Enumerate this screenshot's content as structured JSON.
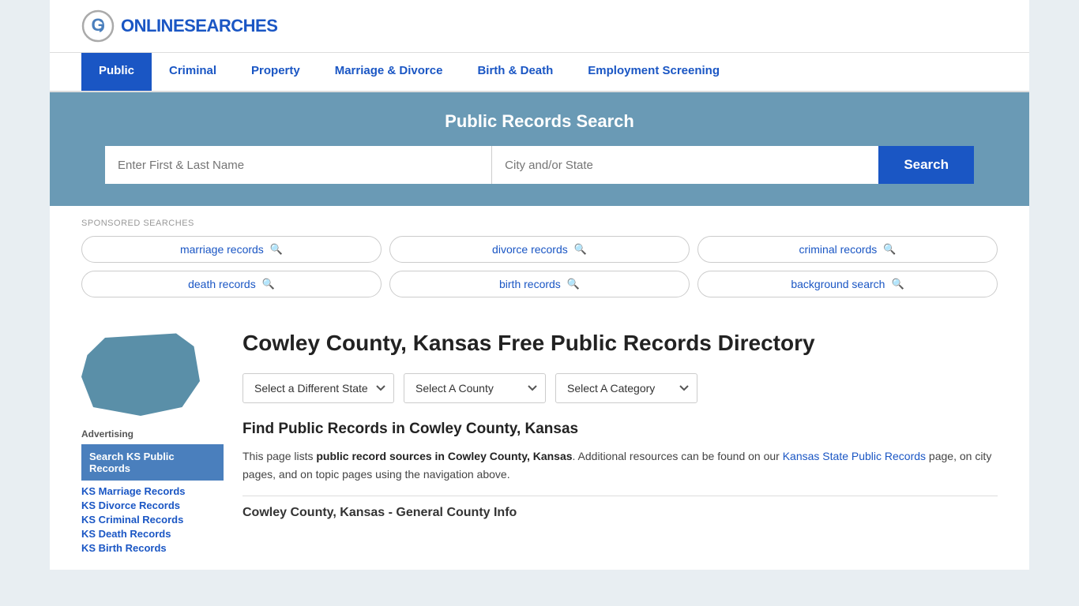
{
  "site": {
    "logo_text_plain": "ONLINE",
    "logo_text_accent": "SEARCHES"
  },
  "nav": {
    "items": [
      {
        "label": "Public",
        "active": true
      },
      {
        "label": "Criminal",
        "active": false
      },
      {
        "label": "Property",
        "active": false
      },
      {
        "label": "Marriage & Divorce",
        "active": false
      },
      {
        "label": "Birth & Death",
        "active": false
      },
      {
        "label": "Employment Screening",
        "active": false
      }
    ]
  },
  "search_banner": {
    "title": "Public Records Search",
    "name_placeholder": "Enter First & Last Name",
    "location_placeholder": "City and/or State",
    "button_label": "Search"
  },
  "sponsored": {
    "label": "SPONSORED SEARCHES",
    "items": [
      {
        "text": "marriage records"
      },
      {
        "text": "divorce records"
      },
      {
        "text": "criminal records"
      },
      {
        "text": "death records"
      },
      {
        "text": "birth records"
      },
      {
        "text": "background search"
      }
    ]
  },
  "sidebar": {
    "advertising_label": "Advertising",
    "ad_active_label": "Search KS Public Records",
    "links": [
      {
        "label": "KS Marriage Records"
      },
      {
        "label": "KS Divorce Records"
      },
      {
        "label": "KS Criminal Records"
      },
      {
        "label": "KS Death Records"
      },
      {
        "label": "KS Birth Records"
      }
    ]
  },
  "main": {
    "page_title": "Cowley County, Kansas Free Public Records Directory",
    "dropdowns": {
      "state_label": "Select a Different State",
      "county_label": "Select A County",
      "category_label": "Select A Category"
    },
    "find_title": "Find Public Records in Cowley County, Kansas",
    "find_desc_prefix": "This page lists ",
    "find_desc_bold": "public record sources in Cowley County, Kansas",
    "find_desc_middle": ". Additional resources can be found on our ",
    "find_desc_link": "Kansas State Public Records",
    "find_desc_suffix": " page, on city pages, and on topic pages using the navigation above.",
    "section_subtitle": "Cowley County, Kansas - General County Info"
  }
}
